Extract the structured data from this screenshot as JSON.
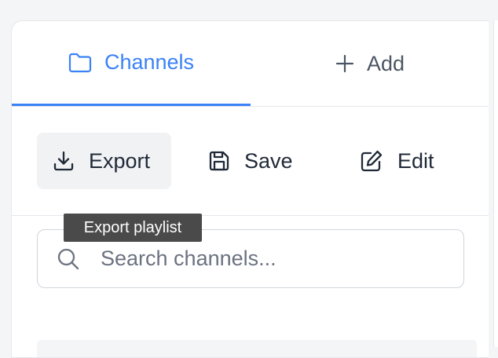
{
  "tabs": [
    {
      "label": "Channels",
      "icon": "folder-icon",
      "active": true
    },
    {
      "label": "Add",
      "icon": "plus-icon",
      "active": false
    }
  ],
  "toolbar": {
    "export_label": "Export",
    "save_label": "Save",
    "edit_label": "Edit"
  },
  "tooltip": {
    "text": "Export playlist"
  },
  "search": {
    "placeholder": "Search channels...",
    "value": ""
  },
  "colors": {
    "accent": "#3b82f6",
    "tooltip_bg": "#4a4a4a",
    "hover_bg": "#f1f2f4"
  }
}
